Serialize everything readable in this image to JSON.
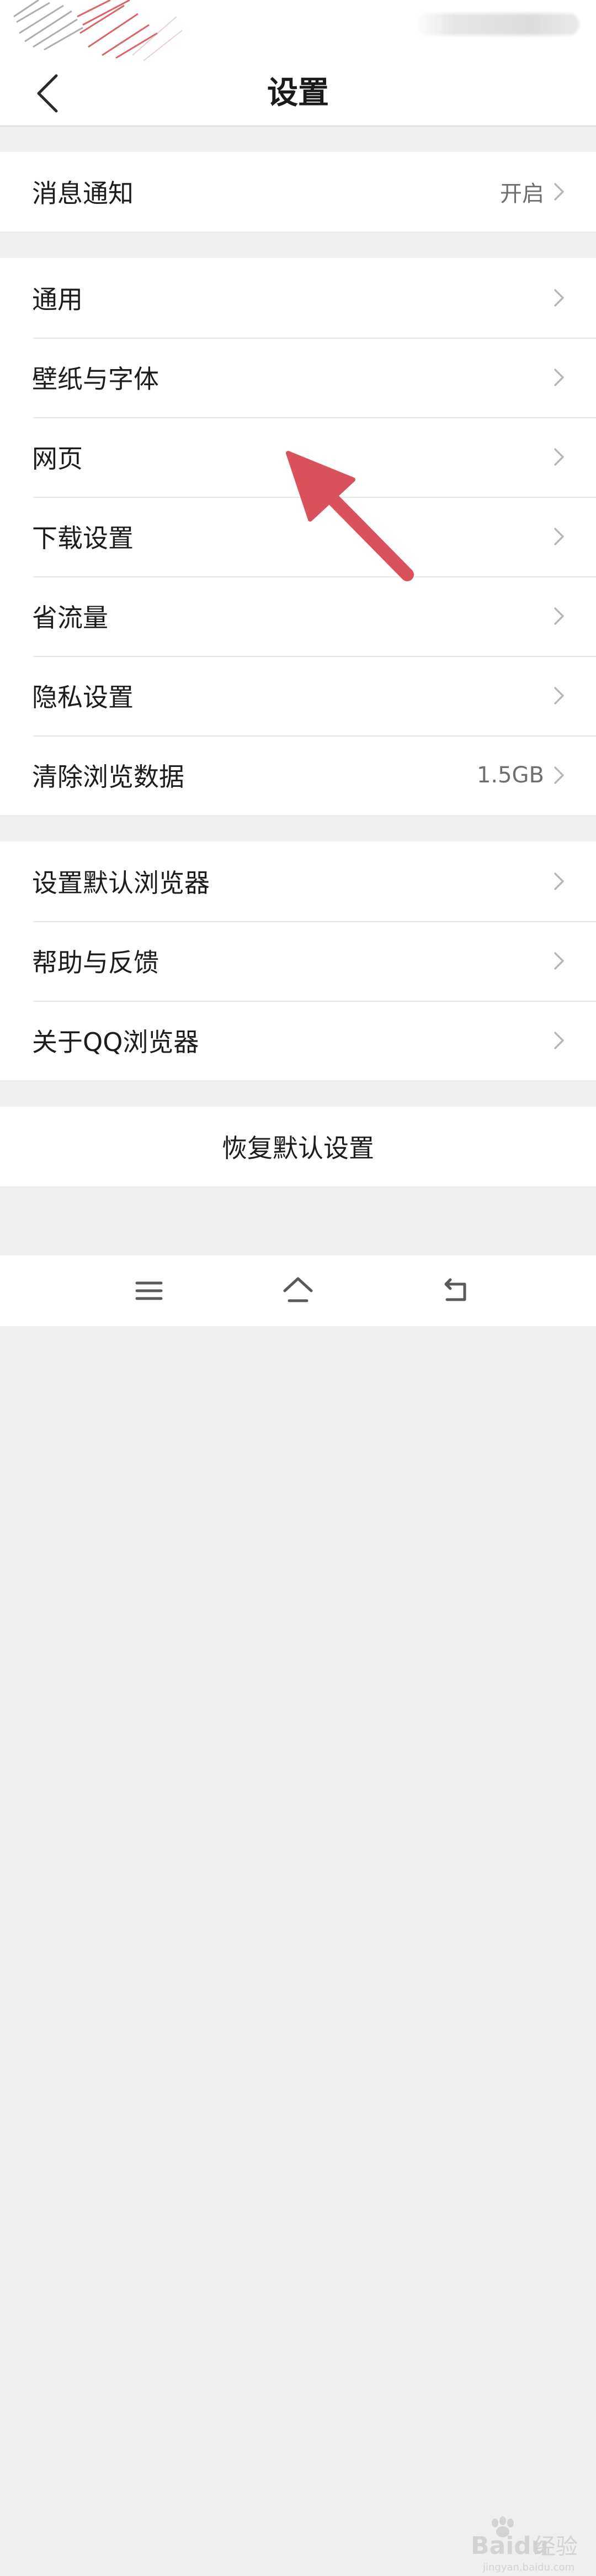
{
  "header": {
    "title": "设置"
  },
  "notifications": {
    "label": "消息通知",
    "value": "开启"
  },
  "main_items": [
    {
      "label": "通用"
    },
    {
      "label": "壁纸与字体"
    },
    {
      "label": "网页"
    },
    {
      "label": "下载设置"
    },
    {
      "label": "省流量"
    },
    {
      "label": "隐私设置"
    },
    {
      "label": "清除浏览数据",
      "value": "1.5GB"
    }
  ],
  "more_items": [
    {
      "label": "设置默认浏览器"
    },
    {
      "label": "帮助与反馈"
    },
    {
      "label": "关于QQ浏览器"
    }
  ],
  "reset": {
    "label": "恢复默认设置"
  },
  "watermark": {
    "text": "Baidu经验",
    "subtext": "jingyan.baidu.com"
  },
  "colors": {
    "annotation_arrow": "#d9525b",
    "background": "#efefef",
    "chevron": "#b8b8b8"
  },
  "icons": [
    "back-arrow-icon",
    "chevron-right-icon",
    "menu-icon",
    "home-icon",
    "back-nav-icon"
  ]
}
